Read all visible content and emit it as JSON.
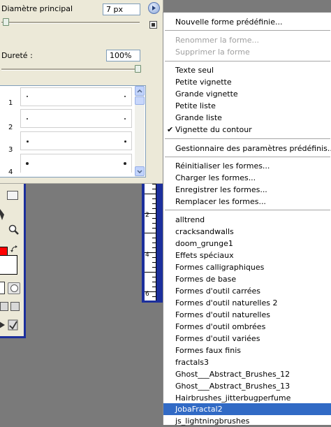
{
  "panel": {
    "diameter_label": "Diamètre principal",
    "diameter_value": "7 px",
    "hardness_label": "Dureté :",
    "hardness_value": "100%",
    "brushes": [
      {
        "number": "1"
      },
      {
        "number": "2"
      },
      {
        "number": "3"
      },
      {
        "number": "4"
      }
    ]
  },
  "ruler": {
    "labels": [
      "2",
      "4",
      "6"
    ]
  },
  "menu": {
    "section1": [
      "Nouvelle forme prédéfinie..."
    ],
    "section2": [
      "Renommer la forme...",
      "Supprimer la forme"
    ],
    "section3": [
      "Texte seul",
      "Petite vignette",
      "Grande vignette",
      "Petite liste",
      "Grande liste",
      "Vignette du contour"
    ],
    "checked_item": "Vignette du contour",
    "section4": [
      "Gestionnaire des paramètres prédéfinis..."
    ],
    "section5": [
      "Réinitialiser les formes...",
      "Charger les formes...",
      "Enregistrer les formes...",
      "Remplacer les formes..."
    ],
    "section6": [
      "alltrend",
      "cracksandwalls",
      "doom_grunge1",
      "Effets spéciaux",
      "Formes calligraphiques",
      "Formes de base",
      "Formes d'outil carrées",
      "Formes d'outil naturelles 2",
      "Formes d'outil naturelles",
      "Formes d'outil ombrées",
      "Formes d'outil variées",
      "Formes faux finis",
      "fractals3",
      "Ghost___Abstract_Brushes_12",
      "Ghost___Abstract_Brushes_13",
      "Hairbrushes_jitterbugperfume",
      "JobaFractal2",
      "js_lightningbrushes"
    ],
    "selected_item": "JobaFractal2"
  },
  "colors": {
    "menu_highlight": "#316ac5",
    "foreground_color": "#ff0000",
    "background_color": "#ffffff",
    "window_border": "#1c2f9c"
  }
}
